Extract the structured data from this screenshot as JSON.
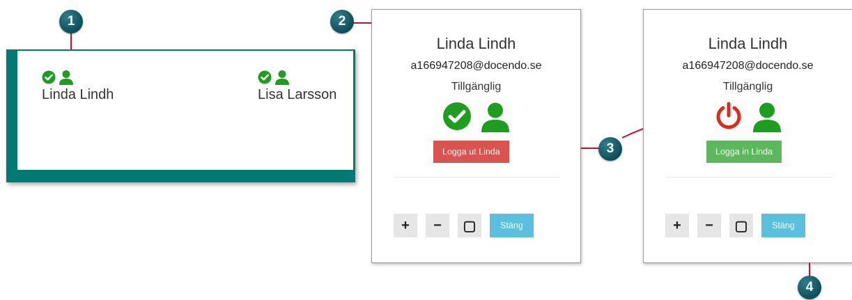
{
  "callouts": [
    "1",
    "2",
    "3",
    "4"
  ],
  "user_list": [
    {
      "name": "Linda Lindh",
      "icons": [
        "check-circle-icon",
        "user-icon"
      ]
    },
    {
      "name": "Lisa Larsson",
      "icons": [
        "check-circle-icon",
        "user-icon"
      ]
    }
  ],
  "panel_logged_in": {
    "name": "Linda Lindh",
    "email": "a166947208@docendo.se",
    "status": "Tillgänglig",
    "status_icon": "check-circle-icon",
    "action_label": "Logga ut Linda",
    "controls": {
      "plus": "+",
      "minus": "−",
      "reset": "▢",
      "close": "Stäng"
    }
  },
  "panel_logged_out": {
    "name": "Linda Lindh",
    "email": "a166947208@docendo.se",
    "status": "Tillgänglig",
    "status_icon": "power-icon",
    "action_label": "Logga in Linda",
    "controls": {
      "plus": "+",
      "minus": "−",
      "reset": "▢",
      "close": "Stäng"
    }
  },
  "colors": {
    "teal": "#007a73",
    "green": "#1e9e1e",
    "red": "#d9534f",
    "power_red": "#e02a1a",
    "login_green": "#5cb85c",
    "close_blue": "#5bc0de",
    "callout": "#0f4e58",
    "leader_line": "#c8102e"
  }
}
